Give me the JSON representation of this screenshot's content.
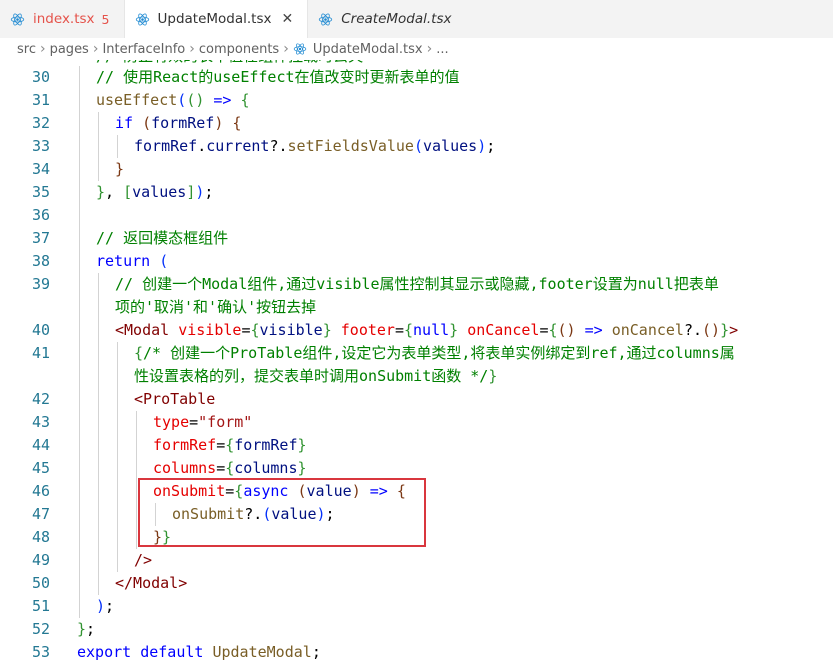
{
  "tabs": [
    {
      "label": "index.tsx",
      "problems": "5",
      "state": "error"
    },
    {
      "label": "UpdateModal.tsx",
      "close": "✕",
      "state": "active"
    },
    {
      "label": "CreateModal.tsx",
      "state": "preview"
    }
  ],
  "breadcrumb": {
    "items": [
      "src",
      "pages",
      "InterfaceInfo",
      "components"
    ],
    "file": "UpdateModal.tsx",
    "more": "..."
  },
  "editor": {
    "partial_line_text": "// 防止有效的表单值在组件挂载时丢失",
    "line_numbers": [
      "30",
      "31",
      "32",
      "33",
      "34",
      "35",
      "36",
      "37",
      "38",
      "39",
      "",
      "40",
      "41",
      "",
      "42",
      "43",
      "44",
      "45",
      "46",
      "47",
      "48",
      "49",
      "50",
      "51",
      "52",
      "53"
    ],
    "line_tokens": [
      [
        [
          "cm",
          "// 使用React的useEffect在值改变时更新表单的值"
        ]
      ],
      [
        [
          "fn",
          "useEffect"
        ],
        [
          "b1",
          "("
        ],
        [
          "b2",
          "()"
        ],
        [
          "p",
          " "
        ],
        [
          "kw",
          "=>"
        ],
        [
          "p",
          " "
        ],
        [
          "b2",
          "{"
        ]
      ],
      [
        [
          "kw",
          "if"
        ],
        [
          "p",
          " "
        ],
        [
          "b3",
          "("
        ],
        [
          "vr",
          "formRef"
        ],
        [
          "b3",
          ")"
        ],
        [
          "p",
          " "
        ],
        [
          "b3",
          "{"
        ]
      ],
      [
        [
          "vr",
          "formRef"
        ],
        [
          "p",
          "."
        ],
        [
          "vr",
          "current"
        ],
        [
          "p",
          "?."
        ],
        [
          "fn",
          "setFieldsValue"
        ],
        [
          "b1",
          "("
        ],
        [
          "vr",
          "values"
        ],
        [
          "b1",
          ")"
        ],
        [
          "p",
          ";"
        ]
      ],
      [
        [
          "b3",
          "}"
        ]
      ],
      [
        [
          "b2",
          "}"
        ],
        [
          "p",
          ", "
        ],
        [
          "b2",
          "["
        ],
        [
          "vr",
          "values"
        ],
        [
          "b2",
          "]"
        ],
        [
          "b1",
          ")"
        ],
        [
          "p",
          ";"
        ]
      ],
      [],
      [
        [
          "cm",
          "// 返回模态框组件"
        ]
      ],
      [
        [
          "kw",
          "return"
        ],
        [
          "p",
          " "
        ],
        [
          "b1",
          "("
        ]
      ],
      [
        [
          "cm",
          "// 创建一个Modal组件,通过visible属性控制其显示或隐藏,footer设置为null把表单"
        ]
      ],
      [
        [
          "cm",
          "项的'取消'和'确认'按钮去掉"
        ]
      ],
      [
        [
          "tg",
          "<Modal"
        ],
        [
          "p",
          " "
        ],
        [
          "at",
          "visible"
        ],
        [
          "p",
          "="
        ],
        [
          "b2",
          "{"
        ],
        [
          "vr",
          "visible"
        ],
        [
          "b2",
          "}"
        ],
        [
          "p",
          " "
        ],
        [
          "at",
          "footer"
        ],
        [
          "p",
          "="
        ],
        [
          "b2",
          "{"
        ],
        [
          "kw",
          "null"
        ],
        [
          "b2",
          "}"
        ],
        [
          "p",
          " "
        ],
        [
          "at",
          "onCancel"
        ],
        [
          "p",
          "="
        ],
        [
          "b2",
          "{"
        ],
        [
          "b3",
          "()"
        ],
        [
          "p",
          " "
        ],
        [
          "kw",
          "=>"
        ],
        [
          "p",
          " "
        ],
        [
          "fn",
          "onCancel"
        ],
        [
          "p",
          "?."
        ],
        [
          "b3",
          "()"
        ],
        [
          "b2",
          "}"
        ],
        [
          "tg",
          ">"
        ]
      ],
      [
        [
          "b2",
          "{"
        ],
        [
          "cm",
          "/* 创建一个ProTable组件,设定它为表单类型,将表单实例绑定到ref,通过columns属"
        ]
      ],
      [
        [
          "cm",
          "性设置表格的列，提交表单时调用onSubmit函数 */"
        ],
        [
          "b2",
          "}"
        ]
      ],
      [
        [
          "tg",
          "<ProTable"
        ]
      ],
      [
        [
          "at",
          "type"
        ],
        [
          "p",
          "="
        ],
        [
          "st",
          "\"form\""
        ]
      ],
      [
        [
          "at",
          "formRef"
        ],
        [
          "p",
          "="
        ],
        [
          "b2",
          "{"
        ],
        [
          "vr",
          "formRef"
        ],
        [
          "b2",
          "}"
        ]
      ],
      [
        [
          "at",
          "columns"
        ],
        [
          "p",
          "="
        ],
        [
          "b2",
          "{"
        ],
        [
          "vr",
          "columns"
        ],
        [
          "b2",
          "}"
        ]
      ],
      [
        [
          "at",
          "onSubmit"
        ],
        [
          "p",
          "="
        ],
        [
          "b2",
          "{"
        ],
        [
          "kw",
          "async"
        ],
        [
          "p",
          " "
        ],
        [
          "b3",
          "("
        ],
        [
          "vr",
          "value"
        ],
        [
          "b3",
          ")"
        ],
        [
          "p",
          " "
        ],
        [
          "kw",
          "=>"
        ],
        [
          "p",
          " "
        ],
        [
          "b3",
          "{"
        ]
      ],
      [
        [
          "fn",
          "onSubmit"
        ],
        [
          "p",
          "?."
        ],
        [
          "b1",
          "("
        ],
        [
          "vr",
          "value"
        ],
        [
          "b1",
          ")"
        ],
        [
          "p",
          ";"
        ]
      ],
      [
        [
          "b3",
          "}"
        ],
        [
          "b2",
          "}"
        ]
      ],
      [
        [
          "tg",
          "/>"
        ]
      ],
      [
        [
          "tg",
          "</Modal>"
        ]
      ],
      [
        [
          "b1",
          ")"
        ],
        [
          "p",
          ";"
        ]
      ],
      [
        [
          "b2",
          "}"
        ],
        [
          "p",
          ";"
        ]
      ],
      [
        [
          "kw",
          "export"
        ],
        [
          "p",
          " "
        ],
        [
          "kw",
          "default"
        ],
        [
          "p",
          " "
        ],
        [
          "fn",
          "UpdateModal"
        ],
        [
          "p",
          ";"
        ]
      ]
    ]
  },
  "colors": {
    "keyword": "#0000ff",
    "comment": "#008000",
    "function": "#795e26",
    "variable": "#001080",
    "string": "#a31515",
    "tag": "#800000",
    "attribute": "#e50000",
    "line_number": "#237893",
    "highlight_box": "#d9363e",
    "react_icon": "#1f8ad2"
  },
  "icons": {
    "tab_file": "react-icon",
    "tab_close": "close-icon",
    "breadcrumb_sep": "chevron-right-icon"
  }
}
